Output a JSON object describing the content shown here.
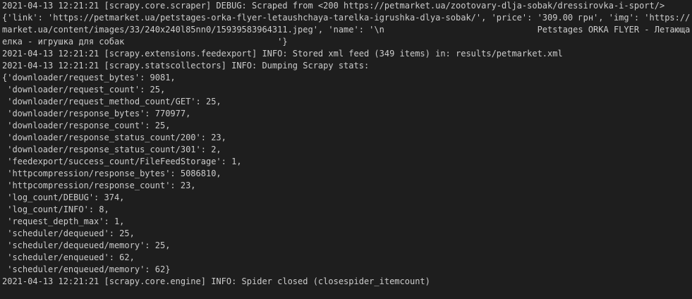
{
  "terminal": {
    "background_color": "#1e1e1e",
    "text_color": "#cccccc",
    "lines": [
      "2021-04-13 12:21:21 [scrapy.core.scraper] DEBUG: Scraped from <200 https://petmarket.ua/zootovary-dlja-sobak/dressirovka-i-sport/>",
      "{'link': 'https://petmarket.ua/petstages-orka-flyer-letaushchaya-tarelka-igrushka-dlya-sobak/', 'price': '309.00 грн', 'img': 'https://pet",
      "market.ua/content/images/33/240x240l85nn0/15939583964311.jpeg', 'name': '\\n                              Petstages ORKA FLYER - Летающая тар",
      "елка - игрушка для собак                              '}",
      "2021-04-13 12:21:21 [scrapy.extensions.feedexport] INFO: Stored xml feed (349 items) in: results/petmarket.xml",
      "2021-04-13 12:21:21 [scrapy.statscollectors] INFO: Dumping Scrapy stats:",
      "{'downloader/request_bytes': 9081,",
      " 'downloader/request_count': 25,",
      " 'downloader/request_method_count/GET': 25,",
      " 'downloader/response_bytes': 770977,",
      " 'downloader/response_count': 25,",
      " 'downloader/response_status_count/200': 23,",
      " 'downloader/response_status_count/301': 2,",
      " 'feedexport/success_count/FileFeedStorage': 1,",
      " 'httpcompression/response_bytes': 5086810,",
      " 'httpcompression/response_count': 23,",
      " 'log_count/DEBUG': 374,",
      " 'log_count/INFO': 8,",
      " 'request_depth_max': 1,",
      " 'scheduler/dequeued': 25,",
      " 'scheduler/dequeued/memory': 25,",
      " 'scheduler/enqueued': 62,",
      " 'scheduler/enqueued/memory': 62}",
      "2021-04-13 12:21:21 [scrapy.core.engine] INFO: Spider closed (closespider_itemcount)"
    ]
  }
}
